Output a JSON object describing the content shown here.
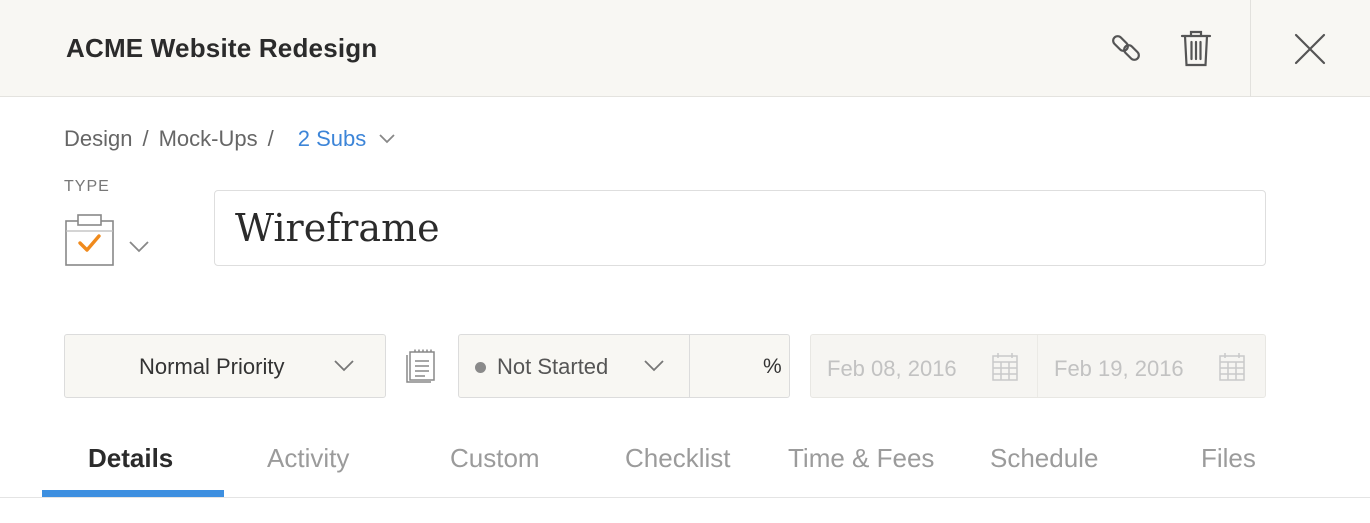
{
  "header": {
    "title": "ACME Website Redesign",
    "icons": [
      "link-icon",
      "trash-icon",
      "close-icon"
    ]
  },
  "breadcrumb": {
    "items": [
      "Design",
      "Mock-Ups"
    ],
    "separator": "/",
    "subs_label": "2 Subs"
  },
  "type": {
    "label": "TYPE",
    "icon": "task-clipboard-icon",
    "accent": "#f08a1c"
  },
  "name": {
    "value": "Wireframe"
  },
  "priority": {
    "value": "Normal Priority"
  },
  "status": {
    "value": "Not Started",
    "percent_value": "",
    "percent_symbol": "%"
  },
  "dates": {
    "start": "Feb 08, 2016",
    "end": "Feb 19, 2016"
  },
  "tabs": [
    {
      "label": "Details",
      "active": true
    },
    {
      "label": "Activity"
    },
    {
      "label": "Custom"
    },
    {
      "label": "Checklist"
    },
    {
      "label": "Time & Fees"
    },
    {
      "label": "Schedule"
    },
    {
      "label": "Files"
    }
  ],
  "colors": {
    "accent_blue": "#3d8fe0",
    "link_blue": "#3d85d8",
    "header_bg": "#f8f7f3"
  }
}
